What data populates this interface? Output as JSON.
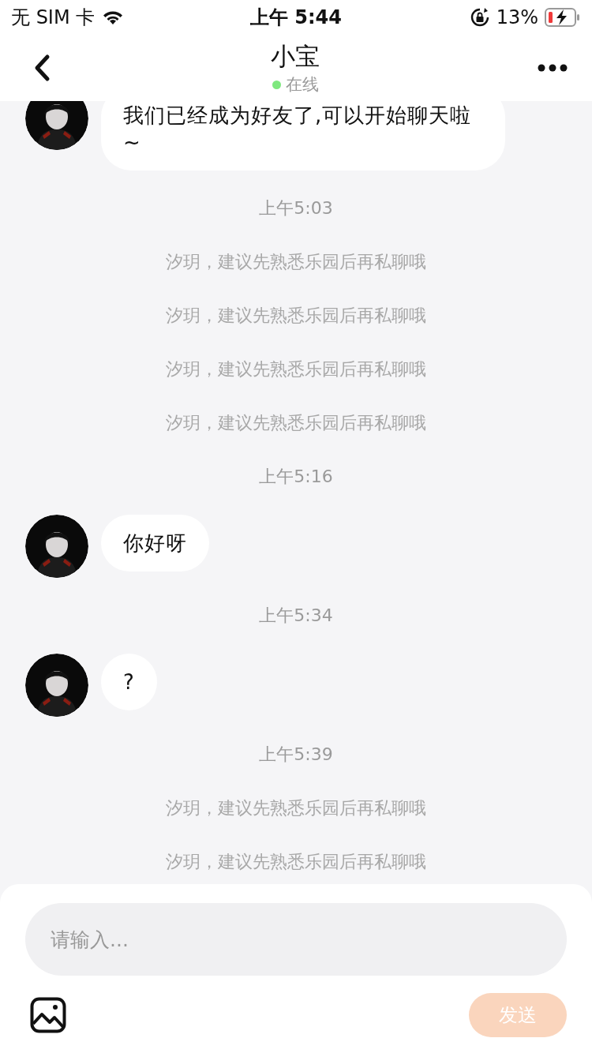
{
  "status_bar": {
    "carrier": "无 SIM 卡",
    "time": "上午 5:44",
    "battery": "13%"
  },
  "header": {
    "title": "小宝",
    "presence": "在线",
    "online": true
  },
  "messages": [
    {
      "kind": "message",
      "text": "我们已经成为好友了,可以开始聊天啦~"
    },
    {
      "kind": "time",
      "text": "上午5:03"
    },
    {
      "kind": "system",
      "text": "汐玥，建议先熟悉乐园后再私聊哦"
    },
    {
      "kind": "system",
      "text": "汐玥，建议先熟悉乐园后再私聊哦"
    },
    {
      "kind": "system",
      "text": "汐玥，建议先熟悉乐园后再私聊哦"
    },
    {
      "kind": "system",
      "text": "汐玥，建议先熟悉乐园后再私聊哦"
    },
    {
      "kind": "time",
      "text": "上午5:16"
    },
    {
      "kind": "message",
      "text": "你好呀"
    },
    {
      "kind": "time",
      "text": "上午5:34"
    },
    {
      "kind": "message",
      "text": "?"
    },
    {
      "kind": "time",
      "text": "上午5:39"
    },
    {
      "kind": "system",
      "text": "汐玥，建议先熟悉乐园后再私聊哦"
    },
    {
      "kind": "system",
      "text": "汐玥，建议先熟悉乐园后再私聊哦"
    }
  ],
  "composer": {
    "placeholder": "请输入...",
    "send_button": {
      "label": "发送",
      "disabled": true
    }
  }
}
